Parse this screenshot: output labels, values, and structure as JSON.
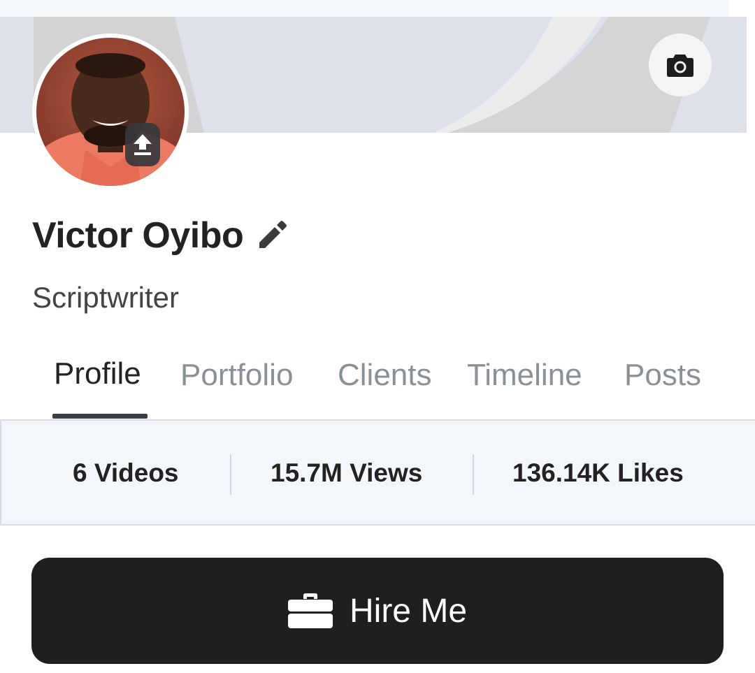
{
  "profile": {
    "name": "Victor Oyibo",
    "role": "Scriptwriter",
    "avatar_alt": "profile photo"
  },
  "icons": {
    "camera": "camera-icon",
    "upload": "upload-icon",
    "edit": "pencil-icon",
    "hire": "briefcase-icon"
  },
  "tabs": [
    {
      "label": "Profile",
      "active": true
    },
    {
      "label": "Portfolio",
      "active": false
    },
    {
      "label": "Clients",
      "active": false
    },
    {
      "label": "Timeline",
      "active": false
    },
    {
      "label": "Posts",
      "active": false
    }
  ],
  "stats": {
    "videos": "6 Videos",
    "views": "15.7M Views",
    "likes": "136.14K Likes"
  },
  "actions": {
    "hire_label": "Hire Me"
  },
  "colors": {
    "cover_bg": "#dde2ea",
    "button_bg": "#1f1f1f",
    "stats_bg": "#f3f6fb",
    "inactive_tab": "#8a9098"
  }
}
